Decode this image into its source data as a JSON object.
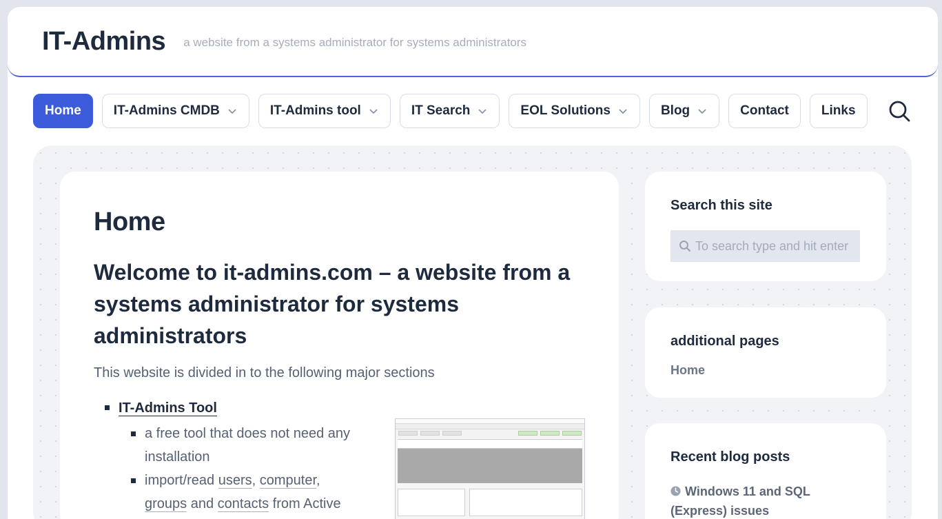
{
  "header": {
    "site_title": "IT-Admins",
    "tagline": "a website from a systems administrator for systems administrators"
  },
  "nav": {
    "items": [
      {
        "label": "Home",
        "active": true,
        "dropdown": false
      },
      {
        "label": "IT-Admins CMDB",
        "active": false,
        "dropdown": true
      },
      {
        "label": "IT-Admins tool",
        "active": false,
        "dropdown": true
      },
      {
        "label": "IT Search",
        "active": false,
        "dropdown": true
      },
      {
        "label": "EOL Solutions",
        "active": false,
        "dropdown": true
      },
      {
        "label": "Blog",
        "active": false,
        "dropdown": true
      },
      {
        "label": "Contact",
        "active": false,
        "dropdown": false
      },
      {
        "label": "Links",
        "active": false,
        "dropdown": false
      }
    ],
    "search_icon": "search-icon"
  },
  "article": {
    "title": "Home",
    "welcome": "Welcome to it-admins.com – a website from a systems administrator for systems administrators",
    "intro": "This website is divided in to the following major sections",
    "sections": [
      {
        "label": "IT-Admins Tool",
        "sub": {
          "item1": "a free tool that does not need any installation",
          "item2_prefix": "import/read ",
          "link_users": "users",
          "sep1": ", ",
          "link_computer": "computer",
          "sep2": ",",
          "link_groups": "groups",
          "sep3": " and ",
          "link_contacts": "contacts",
          "item2_suffix": " from Active"
        }
      }
    ]
  },
  "sidebar": {
    "search": {
      "title": "Search this site",
      "placeholder": "To search type and hit enter"
    },
    "pages": {
      "title": "additional pages",
      "links": [
        "Home"
      ]
    },
    "blog": {
      "title": "Recent blog posts",
      "posts": [
        "Windows 11 and SQL (Express) issues"
      ]
    }
  },
  "colors": {
    "accent": "#3b5bdb",
    "text": "#1e2a3d",
    "muted": "#566173",
    "background": "#e2e5ec"
  }
}
